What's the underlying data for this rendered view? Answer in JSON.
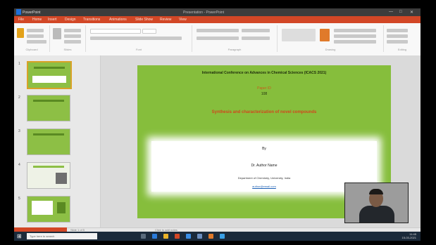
{
  "window": {
    "app_label": "PowerPoint",
    "doc_title": "Presentation - PowerPoint",
    "controls": [
      "—",
      "□",
      "✕"
    ]
  },
  "ribbon": {
    "tabs": [
      "File",
      "Home",
      "Insert",
      "Design",
      "Transitions",
      "Animations",
      "Slide Show",
      "Review",
      "View"
    ],
    "groups": [
      "Clipboard",
      "Slides",
      "Font",
      "Paragraph",
      "Drawing",
      "Editing"
    ]
  },
  "thumbnails": [
    {
      "num": "1"
    },
    {
      "num": "2"
    },
    {
      "num": "3"
    },
    {
      "num": "4"
    },
    {
      "num": "5"
    }
  ],
  "slide": {
    "conference_line": "International Conference on Advances in Chemical Sciences (ICACS 2021)",
    "paper_id": "Paper ID",
    "paper_num": "108",
    "title": "Synthesis and characterization of novel compounds",
    "by": "By",
    "author": "Dr. Author Name",
    "affiliation": "Department of Chemistry, University, India",
    "email": "author@email.com"
  },
  "status": {
    "left": "Slide 1 of 5",
    "notes": "Click to add notes"
  },
  "taskbar": {
    "search_placeholder": "Type here to search",
    "time": "11:45",
    "date": "15-03-2021"
  },
  "colors": {
    "slide_green": "#86be3c",
    "accent_orange": "#d2451c",
    "ribbon_red": "#d24726",
    "taskbar": "#1b2a3a"
  }
}
